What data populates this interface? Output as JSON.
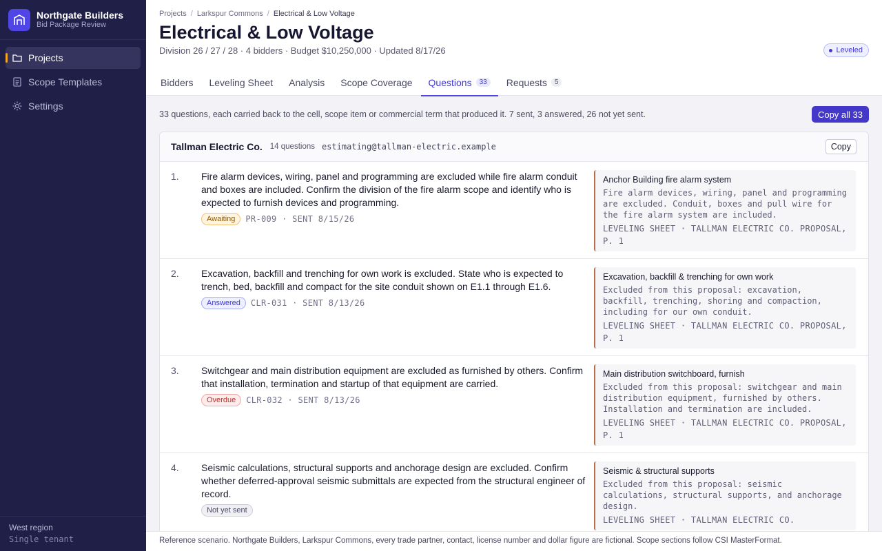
{
  "brand": {
    "name": "Northgate Builders",
    "subtitle": "Bid Package Review"
  },
  "sidebar": {
    "items": [
      {
        "label": "Projects",
        "icon": "folder-icon",
        "active": true
      },
      {
        "label": "Scope Templates",
        "icon": "document-icon",
        "active": false
      },
      {
        "label": "Settings",
        "icon": "gear-icon",
        "active": false
      }
    ],
    "footer": {
      "region": "West region",
      "tenant": "Single tenant"
    }
  },
  "breadcrumb": [
    "Projects",
    "Larkspur Commons",
    "Electrical & Low Voltage"
  ],
  "page": {
    "title": "Electrical & Low Voltage",
    "subtitle": "Division 26 / 27 / 28 · 4 bidders · Budget $10,250,000 · Updated 8/17/26",
    "status": "Leveled"
  },
  "tabs": [
    {
      "label": "Bidders",
      "count": ""
    },
    {
      "label": "Leveling Sheet",
      "count": ""
    },
    {
      "label": "Analysis",
      "count": ""
    },
    {
      "label": "Scope Coverage",
      "count": ""
    },
    {
      "label": "Questions",
      "count": "33",
      "active": true
    },
    {
      "label": "Requests",
      "count": "5"
    }
  ],
  "summary": {
    "text": "33 questions, each carried back to the cell, scope item or commercial term that produced it. 7 sent, 3 answered, 26 not yet sent.",
    "copy_all_label": "Copy all 33"
  },
  "vendor": {
    "name": "Tallman Electric Co.",
    "question_count": "14 questions",
    "email": "estimating@tallman-electric.example",
    "copy_label": "Copy"
  },
  "questions": [
    {
      "num": "1.",
      "text": "Fire alarm devices, wiring, panel and programming are excluded while fire alarm conduit and boxes are included. Confirm the division of the fire alarm scope and identify who is expected to furnish devices and programming.",
      "status": "Awaiting",
      "ref": "PR-009 · SENT 8/15/26",
      "source_title": "Anchor Building fire alarm system",
      "source_body": "Fire alarm devices, wiring, panel and programming are excluded. Conduit, boxes and pull wire for the fire alarm system are included.",
      "source_cite": "LEVELING SHEET · TALLMAN ELECTRIC CO. PROPOSAL, P. 1"
    },
    {
      "num": "2.",
      "text": "Excavation, backfill and trenching for own work is excluded. State who is expected to trench, bed, backfill and compact for the site conduit shown on E1.1 through E1.6.",
      "status": "Answered",
      "ref": "CLR-031 · SENT 8/13/26",
      "source_title": "Excavation, backfill & trenching for own work",
      "source_body": "Excluded from this proposal: excavation, backfill, trenching, shoring and compaction, including for our own conduit.",
      "source_cite": "LEVELING SHEET · TALLMAN ELECTRIC CO. PROPOSAL, P. 1"
    },
    {
      "num": "3.",
      "text": "Switchgear and main distribution equipment are excluded as furnished by others. Confirm that installation, termination and startup of that equipment are carried.",
      "status": "Overdue",
      "ref": "CLR-032 · SENT 8/13/26",
      "source_title": "Main distribution switchboard, furnish",
      "source_body": "Excluded from this proposal: switchgear and main distribution equipment, furnished by others. Installation and termination are included.",
      "source_cite": "LEVELING SHEET · TALLMAN ELECTRIC CO. PROPOSAL, P. 1"
    },
    {
      "num": "4.",
      "text": "Seismic calculations, structural supports and anchorage design are excluded. Confirm whether deferred-approval seismic submittals are expected from the structural engineer of record.",
      "status": "Not yet sent",
      "ref": "",
      "source_title": "Seismic & structural supports",
      "source_body": "Excluded from this proposal: seismic calculations, structural supports, and anchorage design.",
      "source_cite": "LEVELING SHEET · TALLMAN ELECTRIC CO."
    }
  ],
  "footer": "Reference scenario. Northgate Builders, Larkspur Commons, every trade partner, contact, license number and dollar figure are fictional. Scope sections follow CSI MasterFormat."
}
